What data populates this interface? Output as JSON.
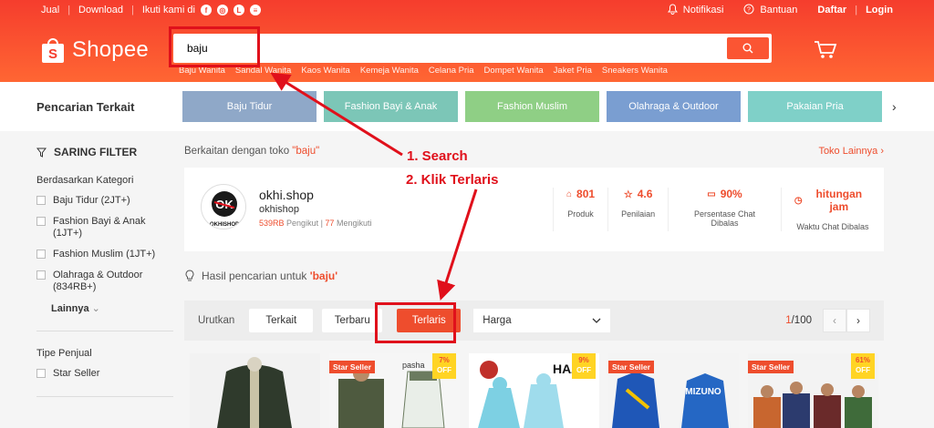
{
  "topbar": {
    "left": [
      "Jual",
      "Download",
      "Ikuti kami di"
    ],
    "notif": "Notifikasi",
    "help": "Bantuan",
    "register": "Daftar",
    "login": "Login"
  },
  "brand": {
    "name": "Shopee"
  },
  "search": {
    "value": "baju",
    "suggestions": [
      "Baju Wanita",
      "Sandal Wanita",
      "Kaos Wanita",
      "Kemeja Wanita",
      "Celana Pria",
      "Dompet Wanita",
      "Jaket Pria",
      "Sneakers Wanita"
    ]
  },
  "related": {
    "title": "Pencarian Terkait",
    "chips": [
      {
        "label": "Baju Tidur",
        "color": "#8fa8c8"
      },
      {
        "label": "Fashion Bayi & Anak",
        "color": "#7cc6b7"
      },
      {
        "label": "Fashion Muslim",
        "color": "#8fcf85"
      },
      {
        "label": "Olahraga & Outdoor",
        "color": "#7a9ed1"
      },
      {
        "label": "Pakaian Pria",
        "color": "#7fd0c8"
      }
    ]
  },
  "filter": {
    "title": "SARING FILTER",
    "category_title": "Berdasarkan Kategori",
    "categories": [
      "Baju Tidur (2JT+)",
      "Fashion Bayi & Anak (1JT+)",
      "Fashion Muslim (1JT+)",
      "Olahraga & Outdoor (834RB+)"
    ],
    "more": "Lainnya",
    "seller_title": "Tipe Penjual",
    "seller_options": [
      "Star Seller"
    ]
  },
  "shop": {
    "related_prefix": "Berkaitan dengan toko ",
    "keyword_quoted": "\"baju\"",
    "more": "Toko Lainnya",
    "name": "okhi.shop",
    "username": "okhishop",
    "followers": "539RB",
    "followers_label": "Pengikut",
    "following": "77",
    "following_label": "Mengikuti",
    "logo_text": "OKHISHOP",
    "stats": [
      {
        "value": "801",
        "label": "Produk"
      },
      {
        "value": "4.6",
        "label": "Penilaian"
      },
      {
        "value": "90%",
        "label": "Persentase Chat Dibalas"
      },
      {
        "value": "hitungan jam",
        "label": "Waktu Chat Dibalas"
      }
    ]
  },
  "results": {
    "prefix": "Hasil pencarian untuk ",
    "keyword": "'baju'"
  },
  "sort": {
    "label": "Urutkan",
    "options": [
      "Terkait",
      "Terbaru",
      "Terlaris"
    ],
    "active": "Terlaris",
    "price": "Harga",
    "page_current": "1",
    "page_total": "/100"
  },
  "products": [
    {
      "badge": "",
      "discount": ""
    },
    {
      "badge": "Star Seller",
      "discount": "7%",
      "brand": "pasha"
    },
    {
      "badge": "",
      "discount": "9%",
      "brand": "HAZM"
    },
    {
      "badge": "Star Seller",
      "discount": "",
      "brand": "MIZUNO"
    },
    {
      "badge": "Star Seller",
      "discount": "61%"
    }
  ],
  "discount_off": "OFF",
  "annotations": {
    "step1": "1. Search",
    "step2": "2. Klik Terlaris",
    "color": "#e0101b"
  }
}
